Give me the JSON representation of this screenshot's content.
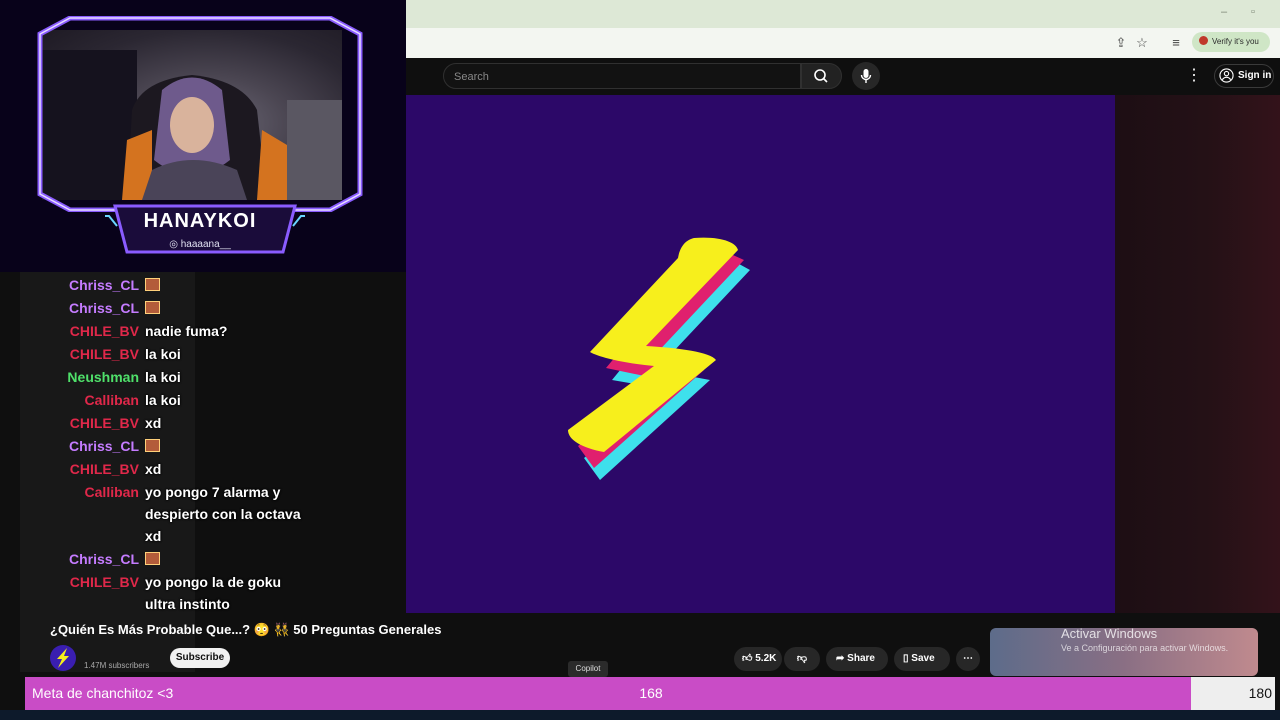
{
  "browser": {
    "verify_label": "Verify it's you"
  },
  "youtube": {
    "search_placeholder": "Search",
    "signin_label": "Sign in"
  },
  "stream": {
    "streamer_name": "HANAYKOI",
    "streamer_handle": "haaaana__"
  },
  "chat": {
    "messages": [
      {
        "user": "Chriss_CL",
        "color": "#c57cff",
        "text": "",
        "emote": true
      },
      {
        "user": "Chriss_CL",
        "color": "#c57cff",
        "text": "",
        "emote": true
      },
      {
        "user": "CHILE_BV",
        "color": "#e0284a",
        "text": "nadie fuma?",
        "emote": false
      },
      {
        "user": "CHILE_BV",
        "color": "#e0284a",
        "text": "la koi",
        "emote": false
      },
      {
        "user": "Neushman",
        "color": "#4fe06a",
        "text": "la koi",
        "emote": false
      },
      {
        "user": "Calliban",
        "color": "#e0284a",
        "text": "la koi",
        "emote": false
      },
      {
        "user": "CHILE_BV",
        "color": "#e0284a",
        "text": "xd",
        "emote": false
      },
      {
        "user": "Chriss_CL",
        "color": "#c57cff",
        "text": "",
        "emote": true
      },
      {
        "user": "CHILE_BV",
        "color": "#e0284a",
        "text": "xd",
        "emote": false
      },
      {
        "user": "Calliban",
        "color": "#e0284a",
        "text": "yo pongo 7 alarma y despierto con la octava xd",
        "emote": false
      },
      {
        "user": "Chriss_CL",
        "color": "#c57cff",
        "text": "",
        "emote": true
      },
      {
        "user": "CHILE_BV",
        "color": "#e0284a",
        "text": "yo pongo la de goku ultra instinto",
        "emote": false
      }
    ]
  },
  "video": {
    "title": "¿Quién Es Más Probable Que...? 😳 👯 50 Preguntas Generales",
    "channel_subs": "1.47M subscribers",
    "subscribe_label": "Subscribe",
    "likes": "5.2K",
    "share_label": "Share",
    "save_label": "Save",
    "copilot_tooltip": "Copilot"
  },
  "watermark": {
    "title": "Activar Windows",
    "subtitle": "Ve a Configuración para activar Windows."
  },
  "goal": {
    "label": "Meta de chanchitoz <3",
    "current": "168",
    "target": "180",
    "progress_fraction": 0.933,
    "fill_color": "#c94cc6"
  },
  "colors": {
    "video_background": "#2c0868",
    "logo_yellow": "#f7ef1c",
    "logo_pink": "#e0206e",
    "logo_cyan": "#3ee0ec",
    "overlay_neon": "#6a3cff"
  }
}
